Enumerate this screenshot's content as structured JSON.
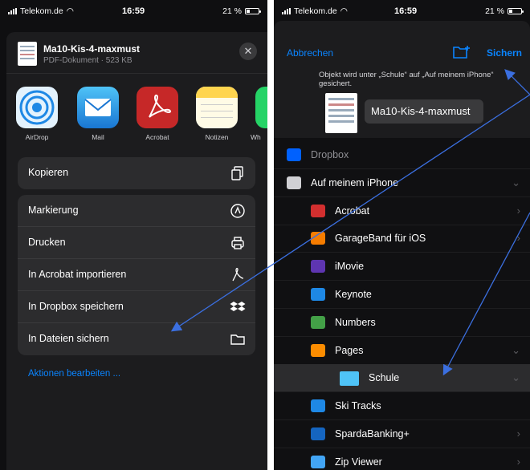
{
  "left": {
    "status": {
      "carrier": "Telekom.de",
      "time": "16:59",
      "battery": "21 %"
    },
    "file": {
      "name": "Ma10-Kis-4-maxmust",
      "meta": "PDF-Dokument · 523 KB"
    },
    "apps": [
      {
        "label": "AirDrop",
        "icon": "airdrop-icon",
        "color": "#1e88e5"
      },
      {
        "label": "Mail",
        "icon": "mail-icon",
        "color": "#2196f3"
      },
      {
        "label": "Acrobat",
        "icon": "acrobat-icon",
        "color": "#d32f2f"
      },
      {
        "label": "Notizen",
        "icon": "notes-icon",
        "color": "#fffbe6"
      },
      {
        "label": "Wh",
        "icon": "whatsapp-icon",
        "color": "#25d366"
      }
    ],
    "actions_group1": [
      {
        "label": "Kopieren",
        "icon": "copy-icon"
      }
    ],
    "actions_group2": [
      {
        "label": "Markierung",
        "icon": "markup-icon"
      },
      {
        "label": "Drucken",
        "icon": "print-icon"
      },
      {
        "label": "In Acrobat importieren",
        "icon": "acrobat-icon"
      },
      {
        "label": "In Dropbox speichern",
        "icon": "dropbox-icon"
      },
      {
        "label": "In Dateien sichern",
        "icon": "folder-icon"
      }
    ],
    "edit_actions": "Aktionen bearbeiten ..."
  },
  "right": {
    "status": {
      "carrier": "Telekom.de",
      "time": "16:59",
      "battery": "21 %"
    },
    "cancel": "Abbrechen",
    "save": "Sichern",
    "save_info": "Objekt wird unter „Schule“ auf „Auf meinem iPhone“ gesichert.",
    "filename": "Ma10-Kis-4-maxmust",
    "tree": [
      {
        "label": "Dropbox",
        "indent": 0,
        "dim": true,
        "color": "#0061fe",
        "chevron": ""
      },
      {
        "label": "Auf meinem iPhone",
        "indent": 0,
        "dim": false,
        "color": "#d0d0d4",
        "chevron": "⌄"
      },
      {
        "label": "Acrobat",
        "indent": 1,
        "dim": false,
        "color": "#d32f2f",
        "chevron": "›"
      },
      {
        "label": "GarageBand für iOS",
        "indent": 1,
        "dim": false,
        "color": "#f57c00",
        "chevron": "›"
      },
      {
        "label": "iMovie",
        "indent": 1,
        "dim": false,
        "color": "#5e35b1",
        "chevron": ""
      },
      {
        "label": "Keynote",
        "indent": 1,
        "dim": false,
        "color": "#1e88e5",
        "chevron": ""
      },
      {
        "label": "Numbers",
        "indent": 1,
        "dim": false,
        "color": "#43a047",
        "chevron": ""
      },
      {
        "label": "Pages",
        "indent": 1,
        "dim": false,
        "color": "#fb8c00",
        "chevron": "⌄"
      },
      {
        "label": "Schule",
        "indent": 2,
        "dim": false,
        "color": "#4fc3f7",
        "chevron": "⌄",
        "selected": true
      },
      {
        "label": "Ski Tracks",
        "indent": 1,
        "dim": false,
        "color": "#1e88e5",
        "chevron": ""
      },
      {
        "label": "SpardaBanking+",
        "indent": 1,
        "dim": false,
        "color": "#1565c0",
        "chevron": "›"
      },
      {
        "label": "Zip Viewer",
        "indent": 1,
        "dim": false,
        "color": "#42a5f5",
        "chevron": "›"
      }
    ]
  }
}
